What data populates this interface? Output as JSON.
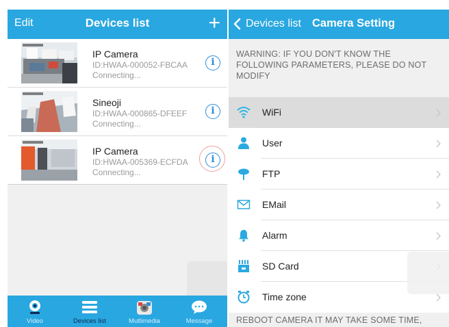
{
  "left": {
    "header": {
      "edit": "Edit",
      "title": "Devices list",
      "add_icon": "plus-icon"
    },
    "devices": [
      {
        "name": "IP Camera",
        "id": "ID:HWAA-000052-FBCAA",
        "status": "Connecting..."
      },
      {
        "name": "Sineoji",
        "id": "ID:HWAA-000865-DFEEF",
        "status": "Connecting..."
      },
      {
        "name": "IP Camera",
        "id": "ID:HWAA-005369-ECFDA",
        "status": "Connecting..."
      }
    ],
    "tabs": [
      {
        "label": "Video",
        "icon": "camera-icon"
      },
      {
        "label": "Devices list",
        "icon": "list-icon"
      },
      {
        "label": "Mutlimedia",
        "icon": "media-icon"
      },
      {
        "label": "Message",
        "icon": "message-icon"
      }
    ]
  },
  "right": {
    "header": {
      "back": "Devices list",
      "title": "Camera Setting"
    },
    "warning": "WARNING: IF YOU DON'T KNOW THE FOLLOWING PARAMETERS, PLEASE DO NOT MODIFY",
    "settings": [
      {
        "label": "WiFi",
        "icon": "wifi-icon"
      },
      {
        "label": "User",
        "icon": "user-icon"
      },
      {
        "label": "FTP",
        "icon": "ftp-icon"
      },
      {
        "label": "EMail",
        "icon": "email-icon"
      },
      {
        "label": "Alarm",
        "icon": "alarm-icon"
      },
      {
        "label": "SD Card",
        "icon": "sd-card-icon"
      },
      {
        "label": "Time zone",
        "icon": "clock-icon"
      }
    ],
    "footer": "REBOOT CAMERA IT MAY TAKE SOME TIME,"
  },
  "colors": {
    "accent": "#29a7e0",
    "info": "#2a8ddb",
    "highlight_ring": "#f0a0a0"
  }
}
